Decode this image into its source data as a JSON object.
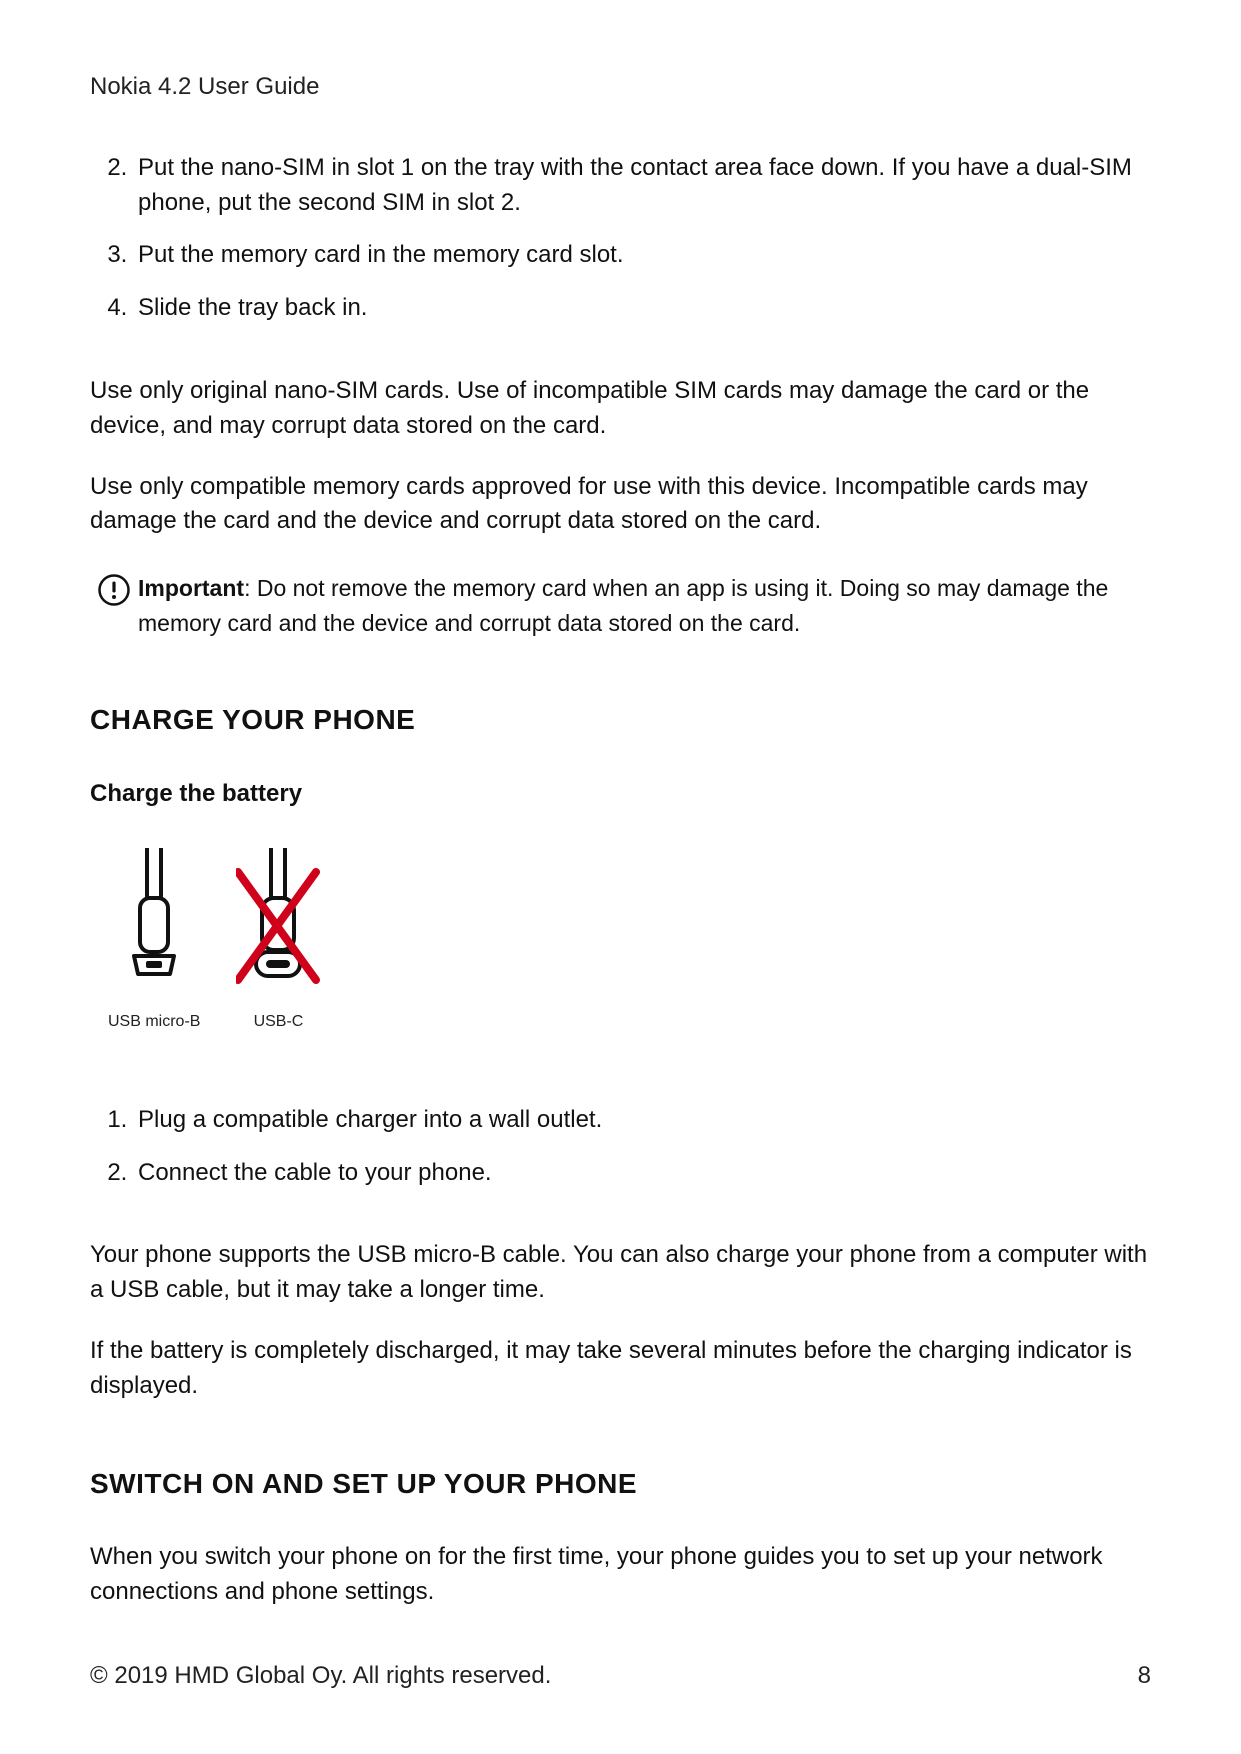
{
  "header": {
    "doc_title": "Nokia 4.2 User Guide"
  },
  "steps_a": {
    "start": 2,
    "items": [
      "Put the nano-SIM in slot 1 on the tray with the contact area face down. If you have a dual-SIM phone, put the second SIM in slot 2.",
      "Put the memory card in the memory card slot.",
      "Slide the tray back in."
    ]
  },
  "body": {
    "sim_warning": "Use only original nano-SIM cards. Use of incompatible SIM cards may damage the card or the device, and may corrupt data stored on the card.",
    "mem_warning": "Use only compatible memory cards approved for use with this device. Incompatible cards may damage the card and the device and corrupt data stored on the card."
  },
  "note": {
    "label": "Important",
    "text": ": Do not remove the memory card when an app is using it. Doing so may damage the memory card and the device and corrupt data stored on the card."
  },
  "sections": {
    "charge_title": "CHARGE YOUR PHONE",
    "charge_sub": "Charge the battery",
    "switch_title": "SWITCH ON AND SET UP YOUR PHONE"
  },
  "figure": {
    "left_label": "USB micro-B",
    "right_label": "USB-C"
  },
  "steps_b": {
    "start": 1,
    "items": [
      "Plug a compatible charger into a wall outlet.",
      "Connect the cable to your phone."
    ]
  },
  "body2": {
    "p1": "Your phone supports the USB micro-B cable. You can also charge your phone from a computer with a USB cable, but it may take a longer time.",
    "p2": "If the battery is completely discharged, it may take several minutes before the charging indicator is displayed."
  },
  "switch_intro": "When you switch your phone on for the first time, your phone guides you to set up your network connections and phone settings.",
  "footer": {
    "copyright": "© 2019 HMD Global Oy. All rights reserved.",
    "page": "8"
  }
}
